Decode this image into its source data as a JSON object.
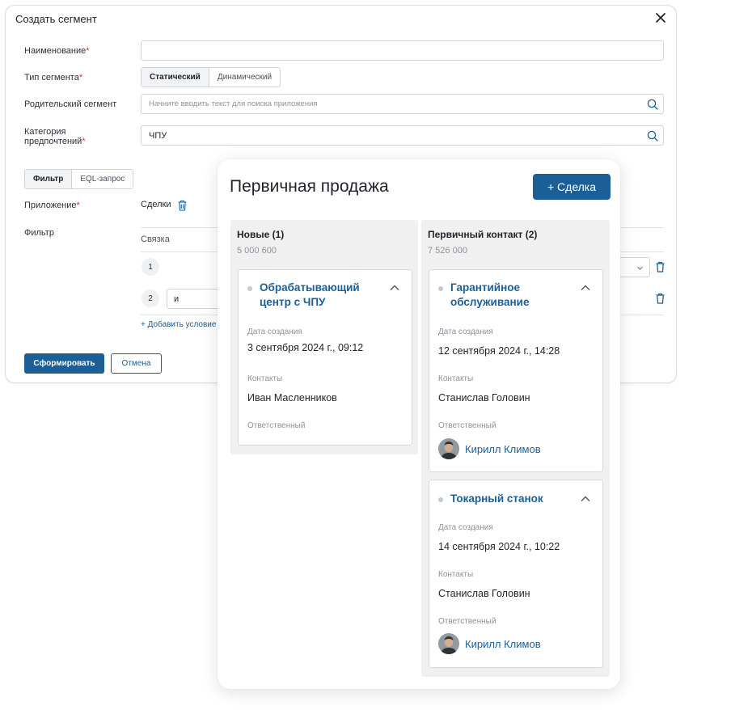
{
  "dialog": {
    "title": "Создать сегмент",
    "name_label": "Наименование",
    "name_value": "",
    "type_label": "Тип сегмента",
    "type_options": [
      "Статический",
      "Динамический"
    ],
    "parent_label": "Родительский сегмент",
    "parent_placeholder": "Начните вводить текст для поиска приложения",
    "category_label": "Категория предпочтений",
    "category_value": "ЧПУ",
    "filter_tabs": [
      "Фильтр",
      "EQL-запрос"
    ],
    "app_label": "Приложение",
    "app_value": "Сделки",
    "filter_label": "Фильтр",
    "link_header": "Связка",
    "rows": [
      {
        "num": "1",
        "op": ""
      },
      {
        "num": "2",
        "op": "и"
      }
    ],
    "add_condition": "+ Добавить условие",
    "submit": "Сформировать",
    "cancel": "Отмена"
  },
  "kanban": {
    "title": "Первичная продажа",
    "new_deal": "+ Сделка",
    "field_labels": {
      "created": "Дата создания",
      "contacts": "Контакты",
      "owner": "Ответственный"
    },
    "columns": [
      {
        "title": "Новые (1)",
        "sum": "5 000 600",
        "cards": [
          {
            "name": "Обрабатывающий центр с ЧПУ",
            "created": "3 сентября 2024 г., 09:12",
            "contact": "Иван Масленников",
            "owner": ""
          }
        ]
      },
      {
        "title": "Первичный контакт (2)",
        "sum": "7 526 000",
        "cards": [
          {
            "name": "Гарантийное обслуживание",
            "created": "12 сентября 2024 г., 14:28",
            "contact": "Станислав Головин",
            "owner": "Кирилл Климов"
          },
          {
            "name": "Токарный станок",
            "created": "14 сентября 2024 г., 10:22",
            "contact": "Станислав Головин",
            "owner": "Кирилл Климов"
          }
        ]
      }
    ]
  },
  "icons": [
    "close-icon",
    "search-icon",
    "trash-icon",
    "chevron-down-icon",
    "chevron-up-icon",
    "avatar"
  ],
  "colors": {
    "accent": "#1c5f96",
    "required": "#d9342b",
    "column_bg": "#f0f0f0"
  }
}
